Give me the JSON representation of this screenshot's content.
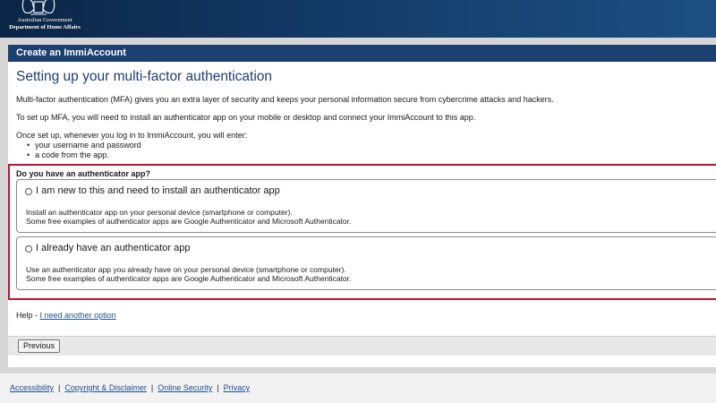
{
  "header": {
    "logo_line1": "Australian Government",
    "logo_line2": "Department of Home Affairs",
    "logo_icon": "coat-of-arms-icon"
  },
  "panel": {
    "title": "Create an ImmiAccount"
  },
  "main": {
    "heading": "Setting up your multi-factor authentication",
    "intro": "Multi-factor authentication (MFA) gives you an extra layer of security and keeps your personal information secure from cybercrime attacks and hackers.",
    "setup": "To set up MFA, you will need to install an authenticator app on your mobile or desktop and connect your ImmiAccount to this app.",
    "once": "Once set up, whenever you log in to ImmiAccount, you will enter:",
    "bullets": [
      "your username and password",
      "a code from the app."
    ]
  },
  "question": {
    "label": "Do you have an authenticator app?",
    "options": [
      {
        "title": "I am new to this and need to install an authenticator app",
        "desc1": "Install an authenticator app on your personal device (smartphone or computer).",
        "desc2": "Some free examples of authenticator apps are Google Authenticator and Microsoft Authenticator.",
        "selected": false
      },
      {
        "title": "I already have an authenticator app",
        "desc1": "Use an authenticator app you already have on your personal device (smartphone or computer).",
        "desc2": "Some free examples of authenticator apps are Google Authenticator and Microsoft Authenticator.",
        "selected": false
      }
    ]
  },
  "help": {
    "prefix": "Help - ",
    "link": "I need another option"
  },
  "buttons": {
    "previous": "Previous"
  },
  "footer": {
    "links": [
      "Accessibility",
      "Copyright & Disclaimer",
      "Online Security",
      "Privacy"
    ],
    "separator": "|"
  },
  "colors": {
    "banner": "#133a66",
    "panel_header": "#1b3f6e",
    "heading": "#1f3c73",
    "highlight_border": "#c8102e",
    "link": "#1f4f8f"
  }
}
